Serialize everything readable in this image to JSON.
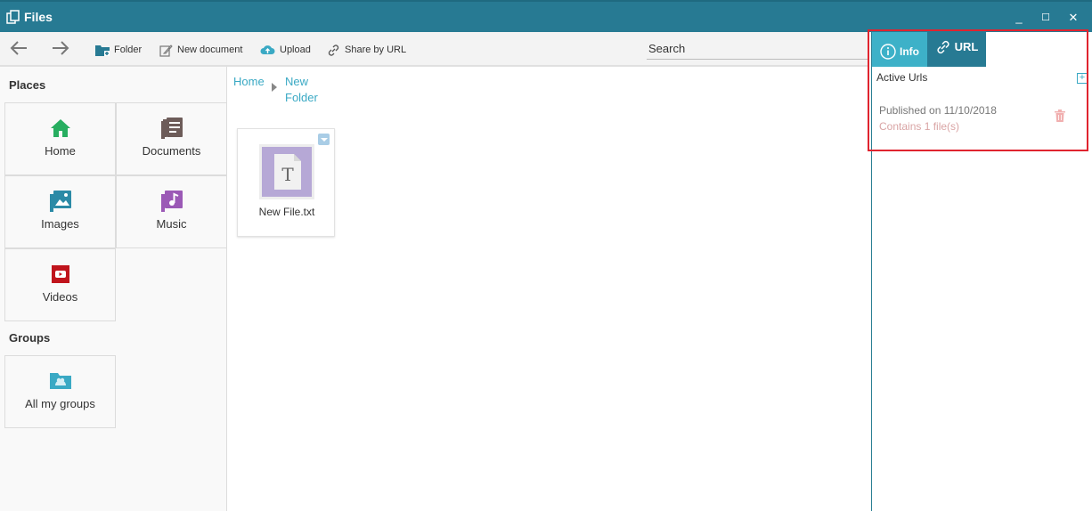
{
  "window": {
    "title": "Files",
    "minimize_label": "_",
    "maximize_label": "☐",
    "close_label": "✕"
  },
  "toolbar": {
    "back_icon": "arrow-left-icon",
    "forward_icon": "arrow-right-icon",
    "folder_label": "Folder",
    "new_document_label": "New document",
    "upload_label": "Upload",
    "share_label": "Share by URL",
    "search_placeholder": "Search"
  },
  "sidebar": {
    "places_title": "Places",
    "places": [
      {
        "label": "Home",
        "icon": "home-icon",
        "color": "#27ae60"
      },
      {
        "label": "Documents",
        "icon": "documents-icon",
        "color": "#6d5c59"
      },
      {
        "label": "Images",
        "icon": "images-icon",
        "color": "#2b8aa6"
      },
      {
        "label": "Music",
        "icon": "music-icon",
        "color": "#9b59b6"
      },
      {
        "label": "Videos",
        "icon": "videos-icon",
        "color": "#c0141c"
      }
    ],
    "groups_title": "Groups",
    "groups": [
      {
        "label": "All my groups",
        "icon": "groups-folder-icon",
        "color": "#3aa9c4"
      }
    ]
  },
  "breadcrumb": {
    "items": [
      "Home",
      "New",
      "Folder"
    ]
  },
  "files": [
    {
      "name": "New File.txt",
      "icon": "text-file-icon",
      "icon_letter": "T"
    }
  ],
  "right_panel": {
    "tabs": [
      {
        "label": "Info",
        "icon": "info-icon"
      },
      {
        "label": "URL",
        "icon": "link-icon"
      }
    ],
    "active_urls_label": "Active Urls",
    "add_label": "+",
    "url_entry": {
      "published": "Published on 11/10/2018",
      "contains": "Contains 1 file(s)"
    }
  },
  "colors": {
    "titlebar": "#277a93",
    "accent": "#3aa9c4",
    "highlight": "#e0242f"
  }
}
